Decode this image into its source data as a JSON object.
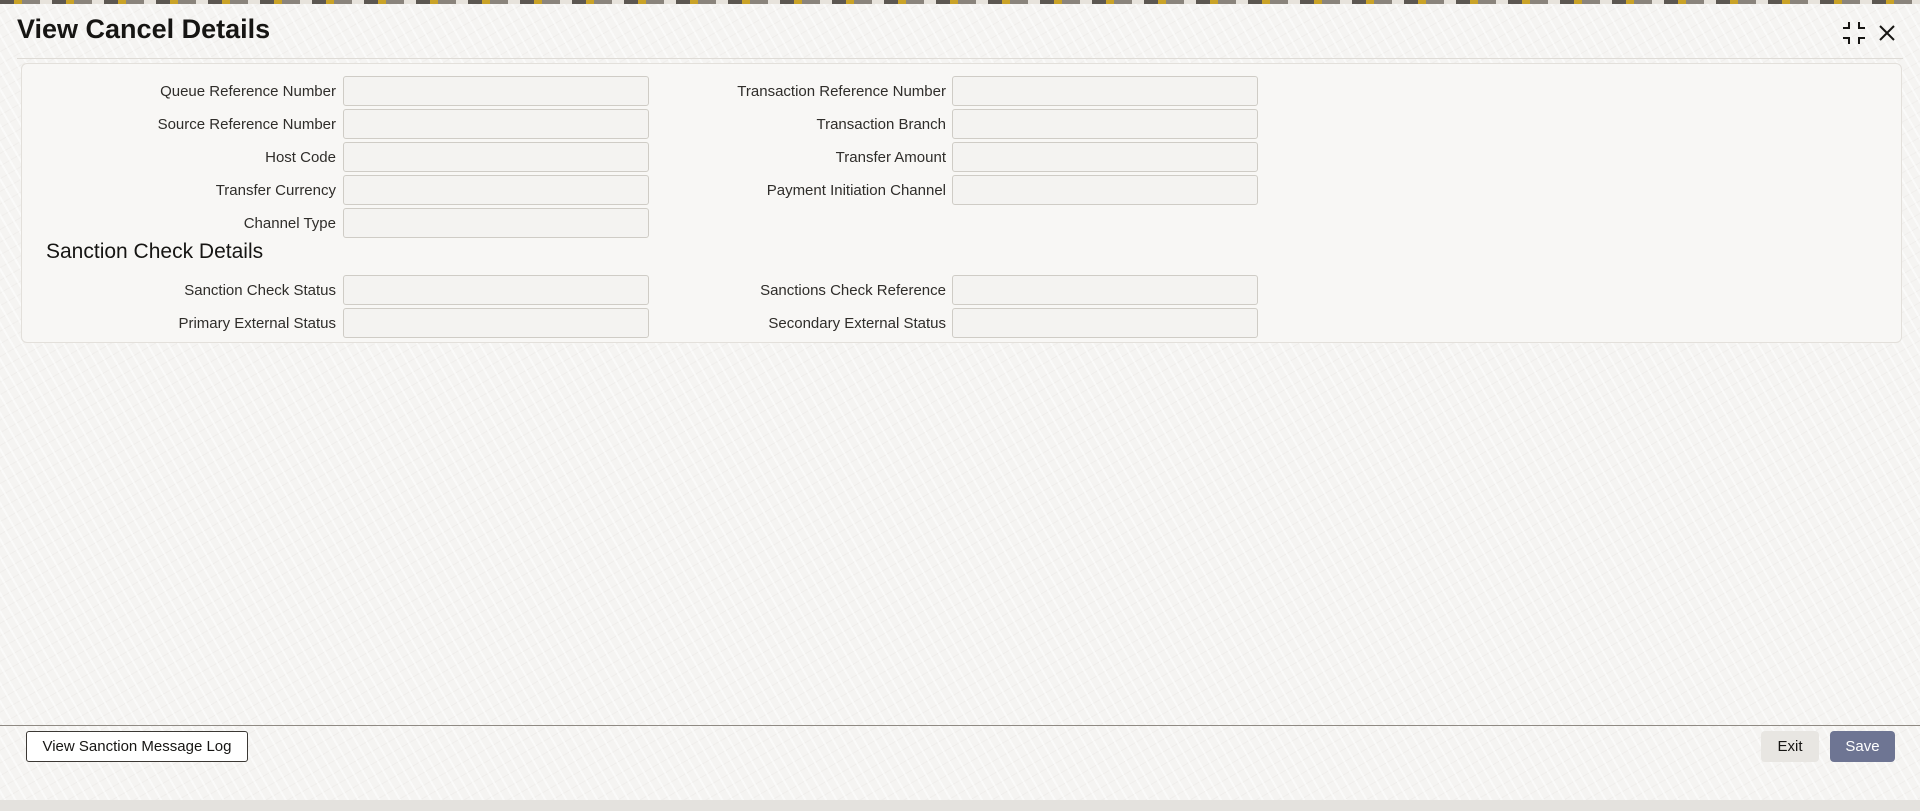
{
  "window": {
    "title": "View Cancel Details",
    "maximize_icon": "maximize-icon",
    "close_icon": "close-icon"
  },
  "fields": {
    "queue_reference_number": {
      "label": "Queue Reference Number",
      "value": ""
    },
    "transaction_reference_number": {
      "label": "Transaction Reference Number",
      "value": ""
    },
    "source_reference_number": {
      "label": "Source Reference Number",
      "value": ""
    },
    "transaction_branch": {
      "label": "Transaction Branch",
      "value": ""
    },
    "host_code": {
      "label": "Host Code",
      "value": ""
    },
    "transfer_amount": {
      "label": "Transfer Amount",
      "value": ""
    },
    "transfer_currency": {
      "label": "Transfer Currency",
      "value": ""
    },
    "payment_initiation_channel": {
      "label": "Payment Initiation Channel",
      "value": ""
    },
    "channel_type": {
      "label": "Channel Type",
      "value": ""
    }
  },
  "sanction_section": {
    "title": "Sanction Check Details",
    "sanction_check_status": {
      "label": "Sanction Check Status",
      "value": ""
    },
    "sanctions_check_reference": {
      "label": "Sanctions Check Reference",
      "value": ""
    },
    "primary_external_status": {
      "label": "Primary External Status",
      "value": ""
    },
    "secondary_external_status": {
      "label": "Secondary External Status",
      "value": ""
    }
  },
  "footer": {
    "view_log_label": "View Sanction Message Log",
    "exit_label": "Exit",
    "save_label": "Save"
  },
  "colors": {
    "save_button_bg": "#6e7593",
    "accent_stripe": "#c9a227"
  }
}
